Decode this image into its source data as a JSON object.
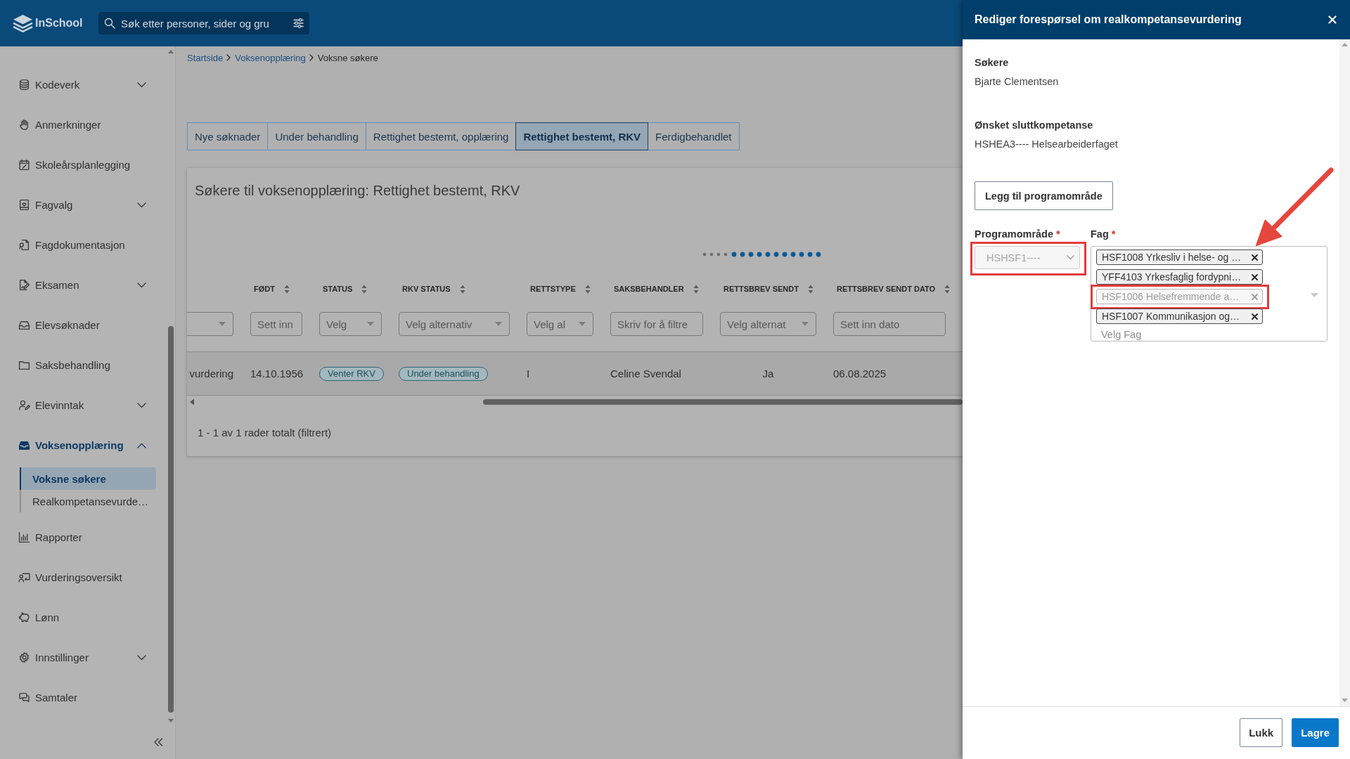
{
  "header": {
    "logo": "InSchool",
    "search": {
      "placeholder": "Søk etter personer, sider og gru"
    }
  },
  "sidebar": {
    "items": [
      {
        "label": "Kodeverk",
        "kind": "group",
        "expanded": false,
        "selected": false
      },
      {
        "label": "Anmerkninger",
        "kind": "link",
        "selected": false
      },
      {
        "label": "Skoleårsplanlegging",
        "kind": "link",
        "selected": false
      },
      {
        "label": "Fagvalg",
        "kind": "group",
        "expanded": false,
        "selected": false
      },
      {
        "label": "Fagdokumentasjon",
        "kind": "link",
        "selected": false
      },
      {
        "label": "Eksamen",
        "kind": "group",
        "expanded": false,
        "selected": false
      },
      {
        "label": "Elevsøknader",
        "kind": "link",
        "selected": false
      },
      {
        "label": "Saksbehandling",
        "kind": "link",
        "selected": false
      },
      {
        "label": "Elevinntak",
        "kind": "group",
        "expanded": false,
        "selected": false
      },
      {
        "label": "Voksenopplæring",
        "kind": "group",
        "expanded": true,
        "selected": true,
        "children": [
          {
            "label": "Voksne søkere",
            "selected": true
          },
          {
            "label": "Realkompetansevurde…",
            "selected": false
          }
        ]
      },
      {
        "label": "Rapporter",
        "kind": "link",
        "selected": false
      },
      {
        "label": "Vurderingsoversikt",
        "kind": "link",
        "selected": false
      },
      {
        "label": "Lønn",
        "kind": "link",
        "selected": false
      },
      {
        "label": "Innstillinger",
        "kind": "group",
        "expanded": false,
        "selected": false
      },
      {
        "label": "Samtaler",
        "kind": "link",
        "selected": false
      }
    ]
  },
  "breadcrumb": [
    {
      "label": "Startside",
      "kind": "link"
    },
    {
      "label": "Voksenopplæring",
      "kind": "link"
    },
    {
      "label": "Voksne søkere",
      "kind": "current"
    }
  ],
  "tabs": [
    {
      "label": "Nye søknader",
      "selected": false
    },
    {
      "label": "Under behandling",
      "selected": false
    },
    {
      "label": "Rettighet bestemt, opplæring",
      "selected": false
    },
    {
      "label": "Rettighet bestemt, RKV",
      "selected": true
    },
    {
      "label": "Ferdigbehandlet",
      "selected": false
    }
  ],
  "results": {
    "title": "Søkere til voksenopplæring: Rettighet bestemt, RKV",
    "table": {
      "columns": [
        {
          "filter": {
            "kind": "select"
          }
        },
        {
          "label": "FØDT",
          "filter": {
            "kind": "text",
            "placeholder": "Sett inn"
          }
        },
        {
          "label": "STATUS",
          "filter": {
            "kind": "select",
            "placeholder": "Velg"
          }
        },
        {
          "label": "RKV STATUS",
          "filter": {
            "kind": "select",
            "placeholder": "Velg alternativ"
          }
        },
        {
          "label": "RETTSTYPE",
          "filter": {
            "kind": "select",
            "placeholder": "Velg al"
          }
        },
        {
          "label": "SAKSBEHANDLER",
          "filter": {
            "kind": "text",
            "placeholder": "Skriv for å filtre"
          }
        },
        {
          "label": "RETTSBREV SENDT",
          "filter": {
            "kind": "select",
            "placeholder": "Velg alternat"
          }
        },
        {
          "label": "RETTSBREV SENDT DATO",
          "filter": {
            "kind": "text",
            "placeholder": "Sett inn dato"
          }
        }
      ],
      "rows": [
        {
          "cells": [
            {
              "text": "vurdering"
            },
            {
              "text": "14.10.1956"
            },
            {
              "kind": "badge",
              "text": "Venter RKV"
            },
            {
              "kind": "badge",
              "text": "Under behandling"
            },
            {
              "text": "I"
            },
            {
              "text": "Celine Svendal"
            },
            {
              "text": "Ja"
            },
            {
              "text": "06.08.2025"
            }
          ]
        }
      ]
    },
    "footer": "1 - 1 av 1 rader totalt (filtrert)"
  },
  "panel": {
    "title": "Rediger forespørsel om realkompetansevurdering",
    "fields": [
      {
        "label": "Søkere",
        "value": "Bjarte Clementsen"
      },
      {
        "label": "Ønsket sluttkompetanse",
        "value": "HSHEA3---- Helsearbeiderfaget"
      }
    ],
    "add_button": "Legg til programområde",
    "programomrade": {
      "label": "Programområde",
      "required_mark": "*",
      "value": "HSHSF1----",
      "disabled": true,
      "highlighted": true
    },
    "fag": {
      "label": "Fag",
      "required_mark": "*",
      "chips": [
        {
          "text": "HSF1008 Yrkesliv i helse- og …",
          "disabled": false,
          "highlighted": false
        },
        {
          "text": "YFF4103 Yrkesfaglig fordypni…",
          "disabled": false,
          "highlighted": false
        },
        {
          "text": "HSF1006 Helsefremmende a…",
          "disabled": true,
          "highlighted": true
        },
        {
          "text": "HSF1007 Kommunikasjon og…",
          "disabled": false,
          "highlighted": false
        }
      ],
      "placeholder": "Velg Fag"
    },
    "buttons": [
      {
        "label": "Lukk",
        "kind": "secondary"
      },
      {
        "label": "Lagre",
        "kind": "primary"
      }
    ]
  }
}
